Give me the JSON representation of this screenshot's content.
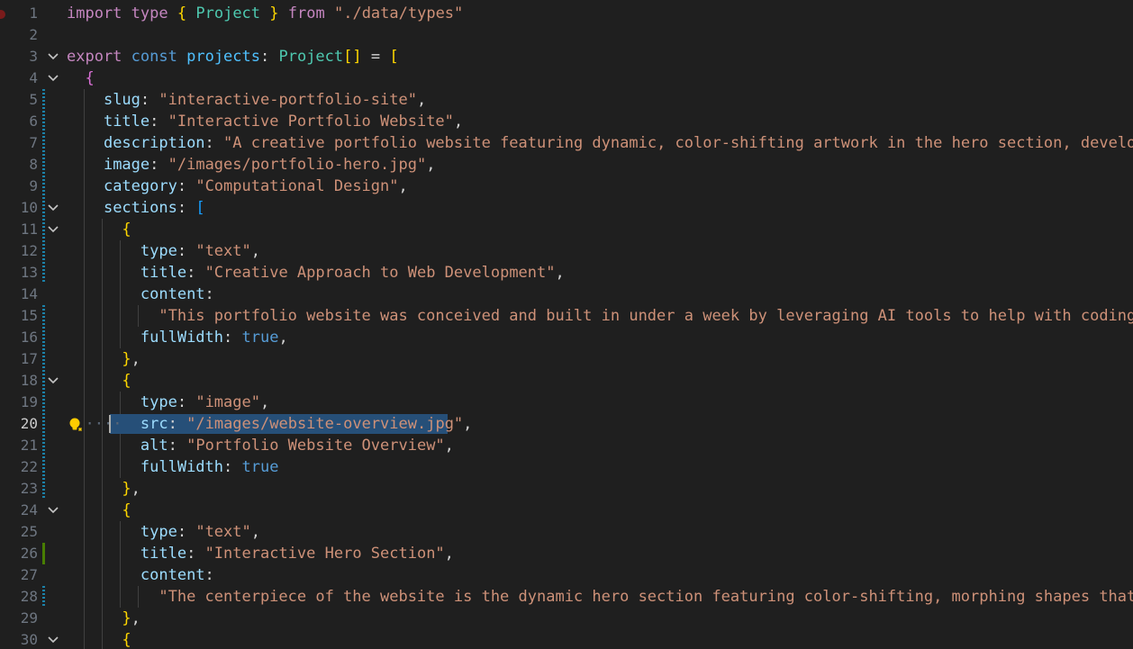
{
  "editor": {
    "active_line": 20,
    "lines": [
      {
        "n": "1",
        "tokens": [
          [
            "k",
            "import"
          ],
          [
            "p",
            " "
          ],
          [
            "k",
            "type"
          ],
          [
            "p",
            " "
          ],
          [
            "b1",
            "{"
          ],
          [
            "p",
            " "
          ],
          [
            "ty",
            "Project"
          ],
          [
            "p",
            " "
          ],
          [
            "b1",
            "}"
          ],
          [
            "p",
            " "
          ],
          [
            "k",
            "from"
          ],
          [
            "p",
            " "
          ],
          [
            "s",
            "\"./data/types\""
          ]
        ]
      },
      {
        "n": "2",
        "tokens": []
      },
      {
        "n": "3",
        "tokens": [
          [
            "k",
            "export"
          ],
          [
            "p",
            " "
          ],
          [
            "kb",
            "const"
          ],
          [
            "p",
            " "
          ],
          [
            "cid",
            "projects"
          ],
          [
            "p",
            ": "
          ],
          [
            "ty",
            "Project"
          ],
          [
            "b1",
            "[]"
          ],
          [
            "p",
            " = "
          ],
          [
            "b1",
            "["
          ]
        ]
      },
      {
        "n": "4",
        "tokens": [
          [
            "p",
            "  "
          ],
          [
            "b2",
            "{"
          ]
        ]
      },
      {
        "n": "5",
        "tokens": [
          [
            "p",
            "    "
          ],
          [
            "id",
            "slug"
          ],
          [
            "p",
            ": "
          ],
          [
            "s",
            "\"interactive-portfolio-site\""
          ],
          [
            "p",
            ","
          ]
        ]
      },
      {
        "n": "6",
        "tokens": [
          [
            "p",
            "    "
          ],
          [
            "id",
            "title"
          ],
          [
            "p",
            ": "
          ],
          [
            "s",
            "\"Interactive Portfolio Website\""
          ],
          [
            "p",
            ","
          ]
        ]
      },
      {
        "n": "7",
        "tokens": [
          [
            "p",
            "    "
          ],
          [
            "id",
            "description"
          ],
          [
            "p",
            ": "
          ],
          [
            "s",
            "\"A creative portfolio website featuring dynamic, color-shifting artwork in the hero section, developed in"
          ]
        ]
      },
      {
        "n": "8",
        "tokens": [
          [
            "p",
            "    "
          ],
          [
            "id",
            "image"
          ],
          [
            "p",
            ": "
          ],
          [
            "s",
            "\"/images/portfolio-hero.jpg\""
          ],
          [
            "p",
            ","
          ]
        ]
      },
      {
        "n": "9",
        "tokens": [
          [
            "p",
            "    "
          ],
          [
            "id",
            "category"
          ],
          [
            "p",
            ": "
          ],
          [
            "s",
            "\"Computational Design\""
          ],
          [
            "p",
            ","
          ]
        ]
      },
      {
        "n": "10",
        "tokens": [
          [
            "p",
            "    "
          ],
          [
            "id",
            "sections"
          ],
          [
            "p",
            ": "
          ],
          [
            "b3",
            "["
          ]
        ]
      },
      {
        "n": "11",
        "tokens": [
          [
            "p",
            "      "
          ],
          [
            "b1",
            "{"
          ]
        ]
      },
      {
        "n": "12",
        "tokens": [
          [
            "p",
            "        "
          ],
          [
            "id",
            "type"
          ],
          [
            "p",
            ": "
          ],
          [
            "s",
            "\"text\""
          ],
          [
            "p",
            ","
          ]
        ]
      },
      {
        "n": "13",
        "tokens": [
          [
            "p",
            "        "
          ],
          [
            "id",
            "title"
          ],
          [
            "p",
            ": "
          ],
          [
            "s",
            "\"Creative Approach to Web Development\""
          ],
          [
            "p",
            ","
          ]
        ]
      },
      {
        "n": "14",
        "tokens": [
          [
            "p",
            "        "
          ],
          [
            "id",
            "content"
          ],
          [
            "p",
            ":"
          ]
        ]
      },
      {
        "n": "15",
        "tokens": [
          [
            "p",
            "          "
          ],
          [
            "s",
            "\"This portfolio website was conceived and built in under a week by leveraging AI tools to help with coding and de"
          ]
        ]
      },
      {
        "n": "16",
        "tokens": [
          [
            "p",
            "        "
          ],
          [
            "id",
            "fullWidth"
          ],
          [
            "p",
            ": "
          ],
          [
            "kb",
            "true"
          ],
          [
            "p",
            ","
          ]
        ]
      },
      {
        "n": "17",
        "tokens": [
          [
            "p",
            "      "
          ],
          [
            "b1",
            "}"
          ],
          [
            "p",
            ","
          ]
        ]
      },
      {
        "n": "18",
        "tokens": [
          [
            "p",
            "      "
          ],
          [
            "b1",
            "{"
          ]
        ]
      },
      {
        "n": "19",
        "tokens": [
          [
            "p",
            "        "
          ],
          [
            "id",
            "type"
          ],
          [
            "p",
            ": "
          ],
          [
            "s",
            "\"image\""
          ],
          [
            "p",
            ","
          ]
        ]
      },
      {
        "n": "20",
        "tokens": [
          [
            "p",
            "  "
          ],
          [
            "ws",
            "····"
          ],
          [
            "p",
            "  "
          ],
          [
            "id",
            "src"
          ],
          [
            "p",
            ": "
          ],
          [
            "s",
            "\"/images/website-overview.jpg\""
          ],
          [
            "p",
            ","
          ]
        ]
      },
      {
        "n": "21",
        "tokens": [
          [
            "p",
            "        "
          ],
          [
            "id",
            "alt"
          ],
          [
            "p",
            ": "
          ],
          [
            "s",
            "\"Portfolio Website Overview\""
          ],
          [
            "p",
            ","
          ]
        ]
      },
      {
        "n": "22",
        "tokens": [
          [
            "p",
            "        "
          ],
          [
            "id",
            "fullWidth"
          ],
          [
            "p",
            ": "
          ],
          [
            "kb",
            "true"
          ]
        ]
      },
      {
        "n": "23",
        "tokens": [
          [
            "p",
            "      "
          ],
          [
            "b1",
            "}"
          ],
          [
            "p",
            ","
          ]
        ]
      },
      {
        "n": "24",
        "tokens": [
          [
            "p",
            "      "
          ],
          [
            "b1",
            "{"
          ]
        ]
      },
      {
        "n": "25",
        "tokens": [
          [
            "p",
            "        "
          ],
          [
            "id",
            "type"
          ],
          [
            "p",
            ": "
          ],
          [
            "s",
            "\"text\""
          ],
          [
            "p",
            ","
          ]
        ]
      },
      {
        "n": "26",
        "tokens": [
          [
            "p",
            "        "
          ],
          [
            "id",
            "title"
          ],
          [
            "p",
            ": "
          ],
          [
            "s",
            "\"Interactive Hero Section\""
          ],
          [
            "p",
            ","
          ]
        ]
      },
      {
        "n": "27",
        "tokens": [
          [
            "p",
            "        "
          ],
          [
            "id",
            "content"
          ],
          [
            "p",
            ":"
          ]
        ]
      },
      {
        "n": "28",
        "tokens": [
          [
            "p",
            "          "
          ],
          [
            "s",
            "\"The centerpiece of the website is the dynamic hero section featuring color-shifting, morphing shapes that respon"
          ]
        ]
      },
      {
        "n": "29",
        "tokens": [
          [
            "p",
            "      "
          ],
          [
            "b1",
            "}"
          ],
          [
            "p",
            ","
          ]
        ]
      },
      {
        "n": "30",
        "tokens": [
          [
            "p",
            "      "
          ],
          [
            "b1",
            "{"
          ]
        ]
      }
    ],
    "colors": {
      "background": "#1f1f1f",
      "selection": "#264f78",
      "line_number": "#6e7681",
      "modified_marker": "#1b81a8",
      "added_marker": "#487e02"
    },
    "icons": {
      "fold": "chevron-down-icon",
      "code_action": "lightbulb-icon",
      "breakpoint": "breakpoint-icon"
    }
  }
}
